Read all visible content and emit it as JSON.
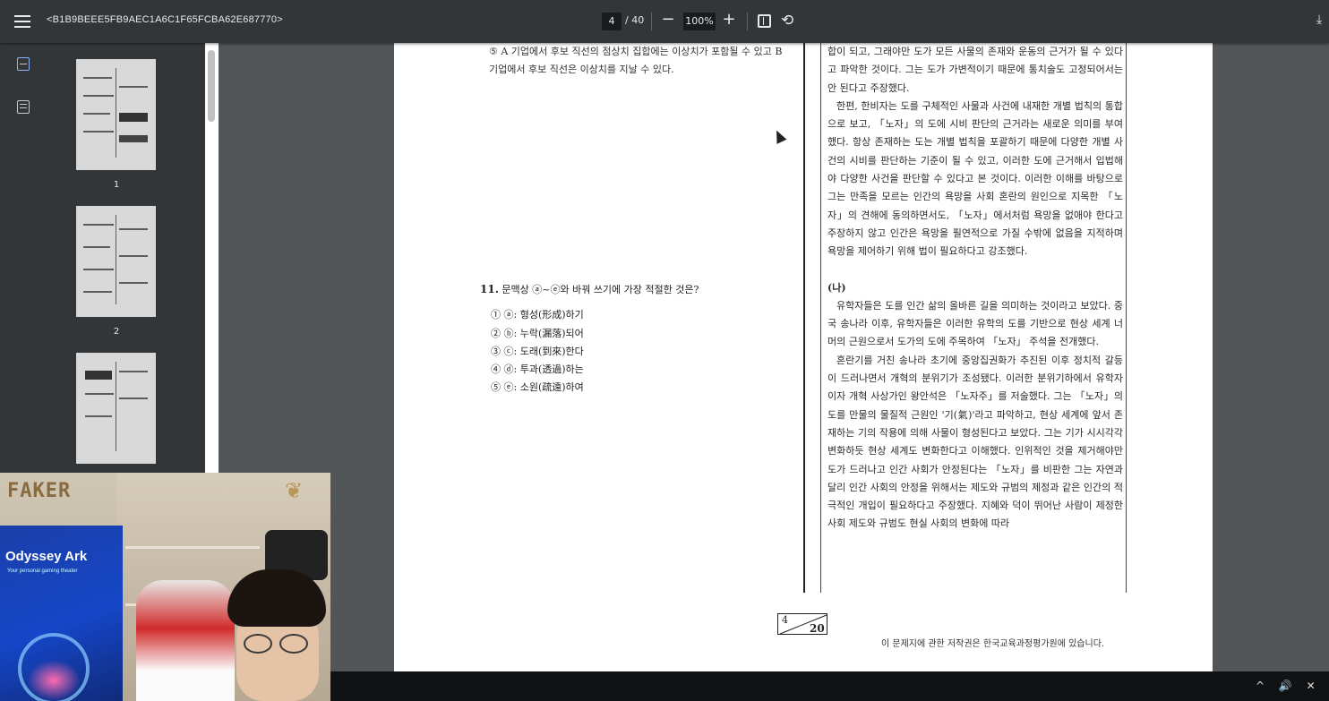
{
  "toolbar": {
    "title": "<B1B9BEEE5FB9AEC1A6C1F65FCBA62E687770>",
    "page_current": "4",
    "page_total": "/ 40",
    "zoom": "100%",
    "minus": "−",
    "plus": "+",
    "rotate": "⟲",
    "download": "⤓"
  },
  "sidebar": {
    "thumbnails": [
      {
        "label": "1"
      },
      {
        "label": "2"
      }
    ]
  },
  "document": {
    "option5_text": "⑤ A 기업에서 후보 직선의 점상치 집합에는 이상치가 포함될 수 있고 B 기업에서 후보 직선은 이상치를 지날 수 있다.",
    "q11_number": "11.",
    "q11_text": "문맥상 ⓐ~ⓔ와 바꿔 쓰기에 가장 적절한 것은?",
    "choices": [
      "① ⓐ: 형성(形成)하기",
      "② ⓑ: 누락(漏落)되어",
      "③ ⓒ: 도래(到來)한다",
      "④ ⓓ: 투과(透過)하는",
      "⑤ ⓔ: 소원(疏遠)하여"
    ],
    "right_top": "합이 되고, 그래야만 도가 모든 사물의 존재와 운동의 근거가 될 수 있다고 파악한 것이다. 그는 도가 가변적이기 때문에 통치술도 고정되어서는 안 된다고 주장했다.",
    "right_p2": "한편, 한비자는 도를 구체적인 사물과 사건에 내재한 개별 법칙의 통합으로 보고, 「노자」의 도에 시비 판단의 근거라는 새로운 의미를 부여했다. 항상 존재하는 도는 개별 법칙을 포괄하기 때문에 다양한 개별 사건의 시비를 판단하는 기준이 될 수 있고, 이러한 도에 근거해서 입법해야 다양한 사건을 판단할 수 있다고 본 것이다. 이러한 이해를 바탕으로 그는 만족을 모르는 인간의 욕망을 사회 혼란의 원인으로 지목한 「노자」의 견해에 동의하면서도, 「노자」에서처럼 욕망을 없애야 한다고 주장하지 않고 인간은 욕망을 필연적으로 가질 수밖에 없음을 지적하며 욕망을 제어하기 위해 법이 필요하다고 강조했다.",
    "section_label": "(나)",
    "right_p3": "유학자들은 도를 인간 삶의 올바른 길을 의미하는 것이라고 보았다. 중국 송나라 이후, 유학자들은 이러한 유학의 도를 기반으로 현상 세계 너머의 근원으로서 도가의 도에 주목하여 「노자」 주석을 전개했다.",
    "right_p4": "혼란기를 거친 송나라 초기에 중앙집권화가 추진된 이후 정치적 갈등이 드러나면서 개혁의 분위기가 조성됐다. 이러한 분위기하에서 유학자이자 개혁 사상가인 왕안석은 「노자주」를 저술했다. 그는 「노자」의 도를 만물의 물질적 근원인 '기(氣)'라고 파악하고, 현상 세계에 앞서 존재하는 기의 작용에 의해 사물이 형성된다고 보았다. 그는 기가 시시각각 변화하듯 현상 세계도 변화한다고 이해했다. 인위적인 것을 제거해야만 도가 드러나고 인간 사회가 안정된다는 「노자」를 비판한 그는 자연과 달리 인간 사회의 안정을 위해서는 제도와 규범의 제정과 같은 인간의 적극적인 개입이 필요하다고 주장했다. 지혜와 덕이 뛰어난 사람이 제정한 사회 제도와 규범도 현실 사회의 변화에 따라",
    "page_num": "4",
    "page_total": "20",
    "copyright": "이 문제지에 관한 저작권은 한국교육과정평가원에 있습니다."
  },
  "webcam": {
    "brand": "FAKER",
    "poster_title": "Odyssey Ark",
    "poster_subtitle": "Your personal gaming theater"
  },
  "taskbar": {
    "tray": "^ 🔊 ✕"
  }
}
